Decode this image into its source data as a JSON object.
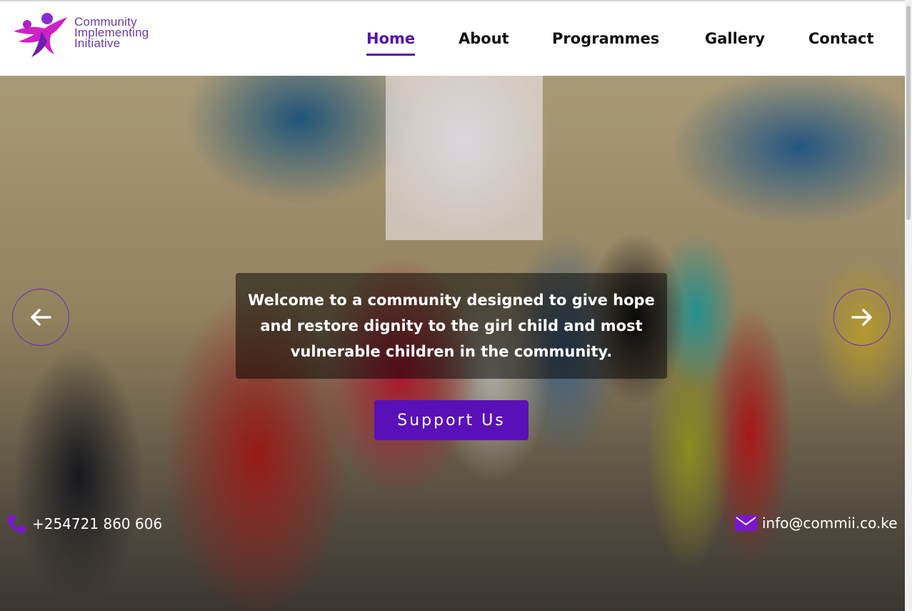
{
  "header": {
    "logo": {
      "line1": "Community",
      "line2": "Implementing",
      "line3": "Initiative"
    },
    "nav": [
      {
        "label": "Home",
        "active": true
      },
      {
        "label": "About",
        "active": false
      },
      {
        "label": "Programmes",
        "active": false
      },
      {
        "label": "Gallery",
        "active": false
      },
      {
        "label": "Contact",
        "active": false
      }
    ]
  },
  "hero": {
    "caption": "Welcome to a community designed to give hope and restore dignity to the girl child and most vulnerable children in the community.",
    "cta_label": "Support Us",
    "prev_icon": "arrow-left-icon",
    "next_icon": "arrow-right-icon"
  },
  "contact": {
    "phone": "+254721 860 606",
    "email": "info@commii.co.ke",
    "phone_icon": "phone-icon",
    "email_icon": "envelope-icon"
  },
  "colors": {
    "accent": "#5512a8",
    "button": "#5a10b8",
    "logo_magenta": "#d020c8"
  }
}
